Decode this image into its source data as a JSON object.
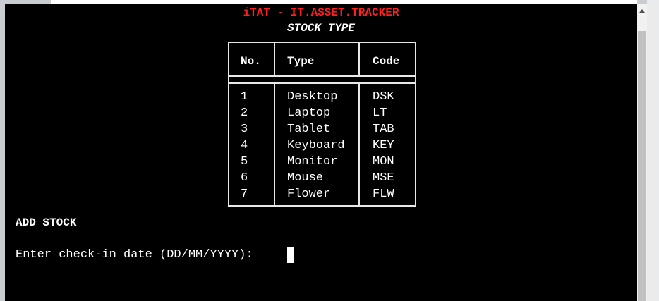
{
  "app": {
    "title": "iTAT - IT.ASSET.TRACKER",
    "subtitle": "STOCK TYPE"
  },
  "table": {
    "headers": [
      "No.",
      "Type",
      "Code"
    ],
    "rows": [
      [
        "1",
        "Desktop",
        "DSK"
      ],
      [
        "2",
        "Laptop",
        "LT"
      ],
      [
        "3",
        "Tablet",
        "TAB"
      ],
      [
        "4",
        "Keyboard",
        "KEY"
      ],
      [
        "5",
        "Monitor",
        "MON"
      ],
      [
        "6",
        "Mouse",
        "MSE"
      ],
      [
        "7",
        "Flower",
        "FLW"
      ]
    ]
  },
  "section": {
    "heading": "ADD STOCK"
  },
  "input": {
    "prompt": "Enter check-in date (DD/MM/YYYY): ",
    "value": ""
  },
  "colors": {
    "background": "#000000",
    "title": "#ff1f1f",
    "text": "#ffffff"
  }
}
